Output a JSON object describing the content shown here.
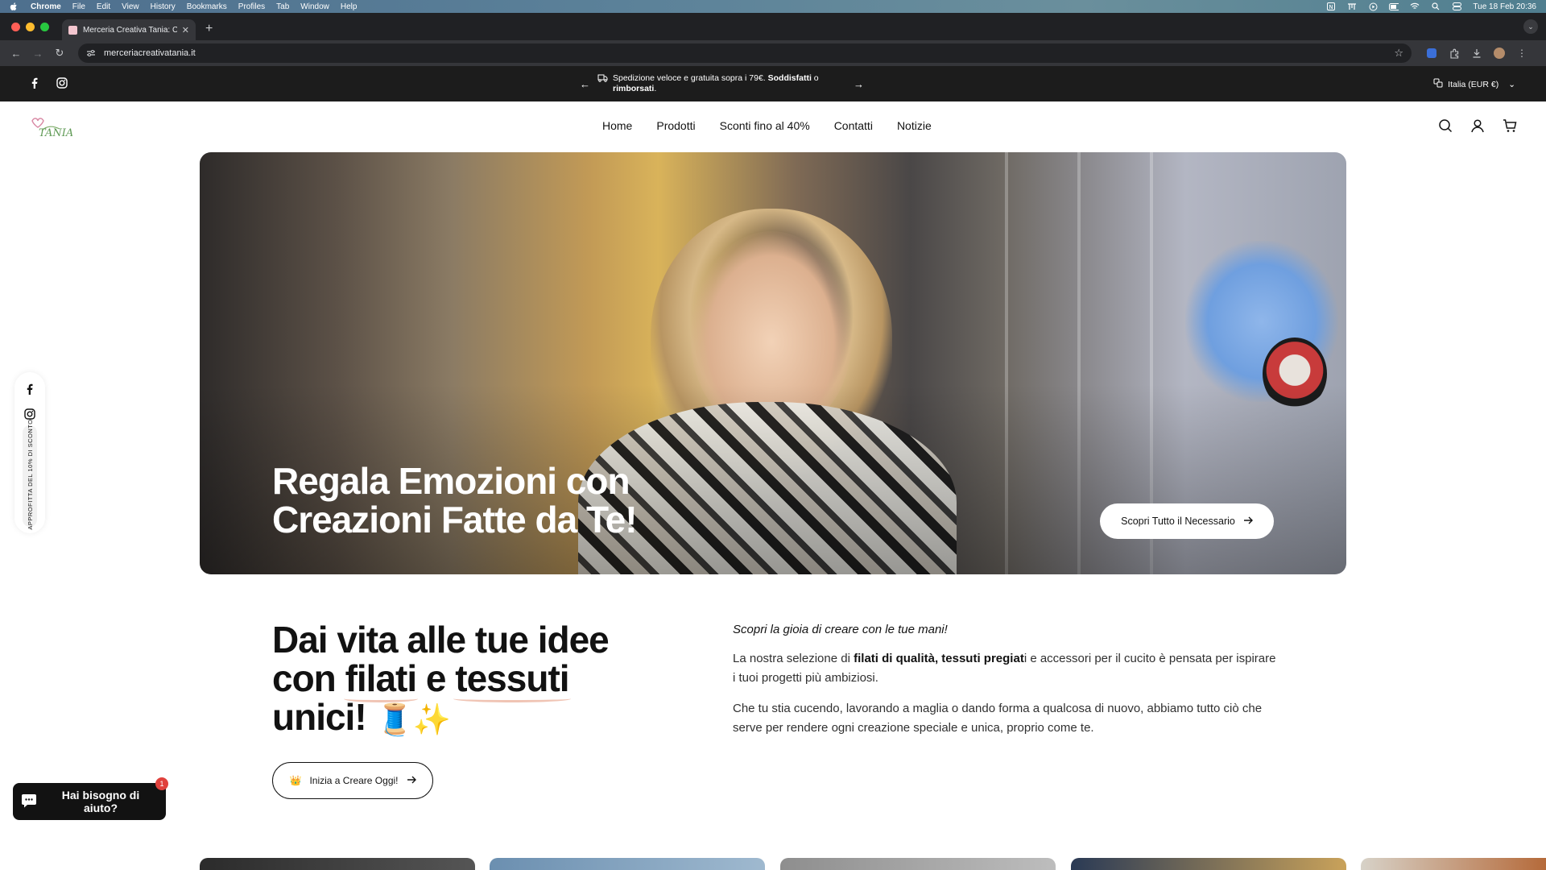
{
  "macos": {
    "app_name": "Chrome",
    "menus": [
      "File",
      "Edit",
      "View",
      "History",
      "Bookmarks",
      "Profiles",
      "Tab",
      "Window",
      "Help"
    ],
    "clock": "Tue 18 Feb  20:36",
    "status_icons": [
      "notion-icon",
      "fan-icon",
      "play-circle-icon",
      "battery-icon",
      "wifi-icon",
      "spotlight-search-icon",
      "control-center-icon"
    ]
  },
  "browser": {
    "tab_title": "Merceria Creativa Tania: Cuc",
    "url": "merceriacreativatania.it",
    "traffic_colors": [
      "#ff5f57",
      "#febc2e",
      "#28c840"
    ]
  },
  "announcement": {
    "text_plain": "Spedizione veloce e gratuita sopra i 79€. ",
    "text_bold1": "Soddisfatti",
    "text_mid": " o ",
    "text_bold2": "rimborsati",
    "text_end": ".",
    "country": "Italia (EUR €)"
  },
  "header": {
    "logo_text": "TANIA",
    "nav": [
      "Home",
      "Prodotti",
      "Sconti fino al 40%",
      "Contatti",
      "Notizie"
    ]
  },
  "hero": {
    "title": "Regala Emozioni con Creazioni Fatte da Te!",
    "button_label": "Scopri Tutto il Necessario"
  },
  "side_rail": {
    "vertical_text": "APPROFITTA DEL 10% DI SCONTO"
  },
  "intro": {
    "heading_part1": "Dai vita alle tue idee con ",
    "heading_ul1": "filati",
    "heading_mid": " e ",
    "heading_ul2": "tessuti",
    "heading_part2": " unici!",
    "heading_emoji": "🧵✨",
    "cta_emoji": "👑",
    "cta_label": "Inizia a Creare Oggi!",
    "lead": "Scopri la gioia di creare con le tue mani!",
    "p1_before": "La nostra selezione di ",
    "p1_bold": "filati di qualità, tessuti pregiat",
    "p1_after": "i e accessori per il cucito è pensata per ispirare i tuoi progetti più ambiziosi.",
    "p2": "Che tu stia cucendo, lavorando a maglia o dando forma a qualcosa di nuovo, abbiamo tutto ciò che serve per rendere ogni creazione speciale e unica, proprio come te."
  },
  "help_chat": {
    "label": "Hai bisogno di aiuto?",
    "badge": "1"
  },
  "colors": {
    "dark": "#1c1c1c",
    "accent_underline": "#f0c4b4",
    "badge": "#e0413c"
  }
}
